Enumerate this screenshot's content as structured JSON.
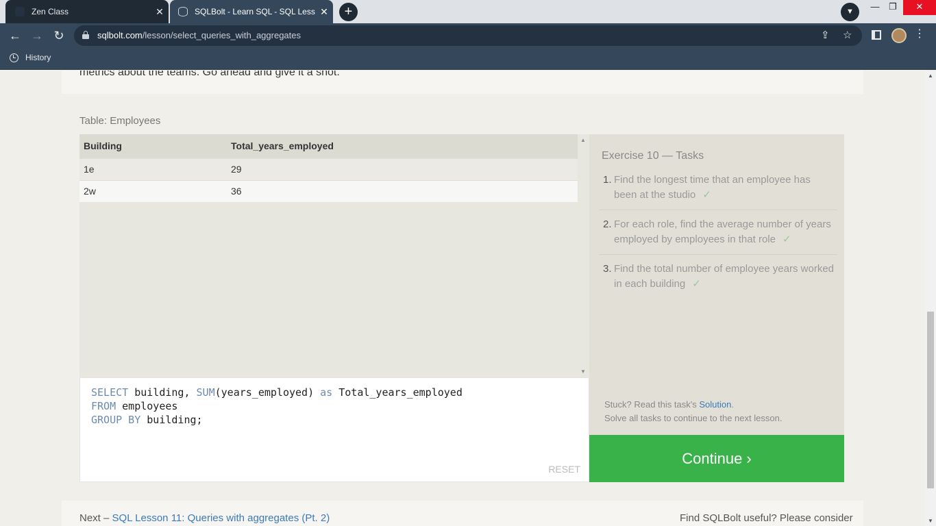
{
  "browser": {
    "tabs": [
      {
        "title": "Zen Class"
      },
      {
        "title": "SQLBolt - Learn SQL - SQL Lesson"
      }
    ],
    "close_glyph": "✕",
    "new_tab_glyph": "+",
    "url_host": "sqlbolt.com",
    "url_path": "/lesson/select_queries_with_aggregates",
    "bookmarks": [
      {
        "label": "History",
        "icon": "history-icon"
      }
    ]
  },
  "page": {
    "intro_text": "metrics about the teams. Go ahead and give it a shot.",
    "table_caption": "Table: Employees",
    "results": {
      "columns": [
        "Building",
        "Total_years_employed"
      ],
      "rows": [
        [
          "1e",
          "29"
        ],
        [
          "2w",
          "36"
        ]
      ]
    },
    "query_lines": [
      {
        "kw": "SELECT",
        "rest": " building, ",
        "kw2": "SUM",
        "rest2": "(years_employed) ",
        "kw3": "as",
        "rest3": " Total_years_employed"
      },
      {
        "kw": "FROM",
        "rest": " employees"
      },
      {
        "kw": "GROUP BY",
        "rest": " building;"
      }
    ],
    "reset_label": "RESET",
    "exercise_title": "Exercise 10 — Tasks",
    "tasks": [
      {
        "num": "1.",
        "text": "Find the longest time that an employee has been at the studio",
        "done": "✓"
      },
      {
        "num": "2.",
        "text": "For each role, find the average number of years employed by employees in that role",
        "done": "✓"
      },
      {
        "num": "3.",
        "text": "Find the total number of employee years worked in each building",
        "done": "✓"
      }
    ],
    "stuck_prefix": "Stuck? Read this task's ",
    "solution_link": "Solution",
    "stuck_suffix": ".",
    "solve_all": "Solve all tasks to continue to the next lesson.",
    "continue_label": "Continue ›",
    "next_prefix": "Next – ",
    "next_link": "SQL Lesson 11: Queries with aggregates (Pt. 2)",
    "footer_note": "Find SQLBolt useful? Please consider"
  }
}
